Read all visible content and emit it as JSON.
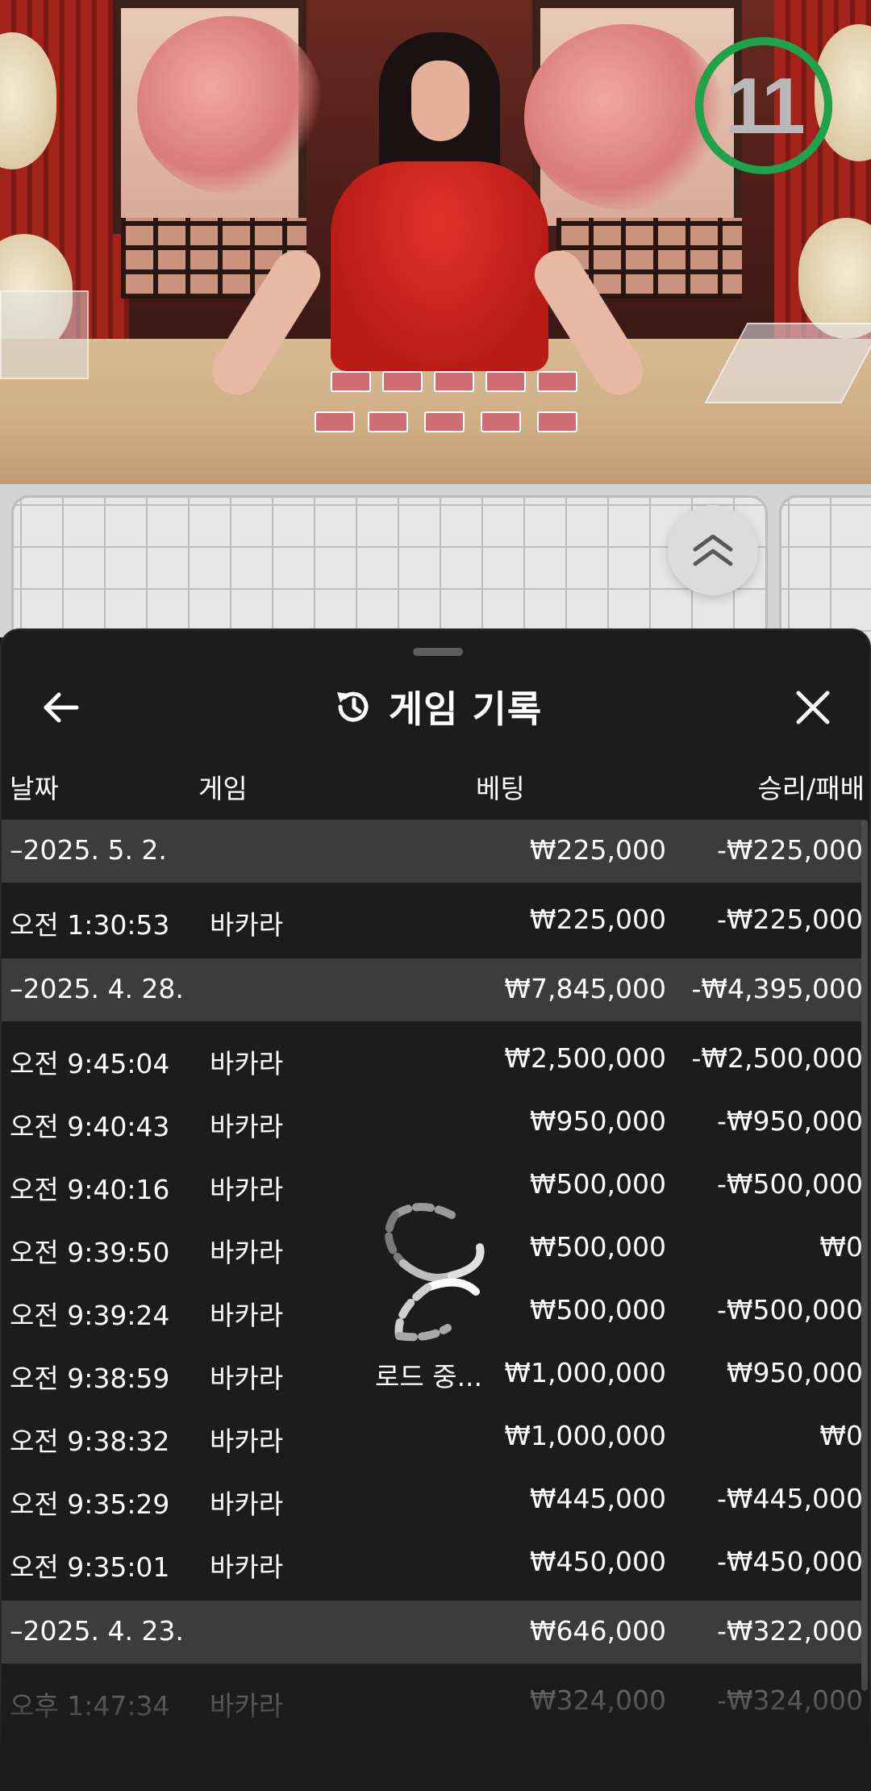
{
  "timer": {
    "value": "11",
    "ring_color": "#1fa34a"
  },
  "road": {
    "expand_icon": "double-chevron-up-icon"
  },
  "sheet": {
    "title": "게임 기록",
    "title_icon": "history-icon",
    "back_icon": "arrow-left-icon",
    "close_icon": "close-icon",
    "columns": {
      "date": "날짜",
      "game": "게임",
      "bet": "베팅",
      "result": "승리/패배"
    },
    "rows": [
      {
        "type": "group",
        "date": "–2025. 5. 2.",
        "game": "",
        "bet": "₩225,000",
        "result": "-₩225,000"
      },
      {
        "type": "item",
        "date": "오전 1:30:53",
        "game": "바카라",
        "bet": "₩225,000",
        "result": "-₩225,000"
      },
      {
        "type": "group",
        "date": "–2025. 4. 28.",
        "game": "",
        "bet": "₩7,845,000",
        "result": "-₩4,395,000"
      },
      {
        "type": "item",
        "date": "오전 9:45:04",
        "game": "바카라",
        "bet": "₩2,500,000",
        "result": "-₩2,500,000"
      },
      {
        "type": "item",
        "date": "오전 9:40:43",
        "game": "바카라",
        "bet": "₩950,000",
        "result": "-₩950,000"
      },
      {
        "type": "item",
        "date": "오전 9:40:16",
        "game": "바카라",
        "bet": "₩500,000",
        "result": "-₩500,000"
      },
      {
        "type": "item",
        "date": "오전 9:39:50",
        "game": "바카라",
        "bet": "₩500,000",
        "result": "₩0"
      },
      {
        "type": "item",
        "date": "오전 9:39:24",
        "game": "바카라",
        "bet": "₩500,000",
        "result": "-₩500,000"
      },
      {
        "type": "item",
        "date": "오전 9:38:59",
        "game": "바카라",
        "bet": "₩1,000,000",
        "result": "₩950,000"
      },
      {
        "type": "item",
        "date": "오전 9:38:32",
        "game": "바카라",
        "bet": "₩1,000,000",
        "result": "₩0"
      },
      {
        "type": "item",
        "date": "오전 9:35:29",
        "game": "바카라",
        "bet": "₩445,000",
        "result": "-₩445,000"
      },
      {
        "type": "item",
        "date": "오전 9:35:01",
        "game": "바카라",
        "bet": "₩450,000",
        "result": "-₩450,000"
      },
      {
        "type": "group",
        "date": "–2025. 4. 23.",
        "game": "",
        "bet": "₩646,000",
        "result": "-₩322,000"
      },
      {
        "type": "item",
        "date": "오후 1:47:34",
        "game": "바카라",
        "bet": "₩324,000",
        "result": "-₩324,000"
      }
    ],
    "loading_text": "로드 중..."
  }
}
